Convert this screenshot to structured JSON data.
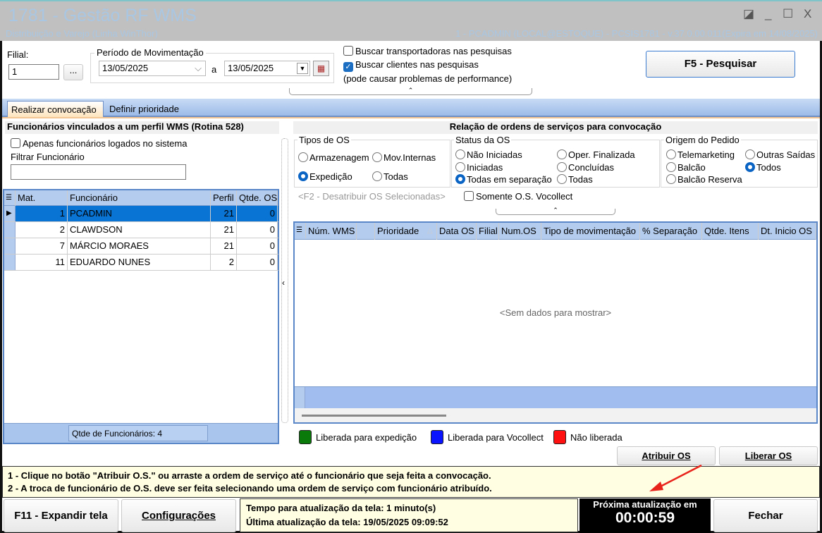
{
  "window": {
    "title": "1781 - Gestão RF WMS",
    "subtitle": "Distribuição e Varejo (Linha WinThor)",
    "sysinfo": "1 - PCADMIN (LOCAL@ESTOQUE) - PCSIS1781 - v.37.0.00.011(Expira em 14/08/2025)",
    "controls": [
      "◪",
      "_",
      "☐",
      "X"
    ]
  },
  "filters": {
    "filial_label": "Filial:",
    "filial_value": "1",
    "lookup_label": "...",
    "periodo_label": "Período de Movimentação",
    "date_from": "13/05/2025",
    "sep": "a",
    "date_to": "13/05/2025",
    "chk_transportadoras": "Buscar transportadoras nas pesquisas",
    "chk_clientes": "Buscar clientes nas pesquisas",
    "chk_note": "(pode causar problemas de performance)",
    "search_button": "F5 - Pesquisar"
  },
  "tabs": [
    "Realizar convocação",
    "Definir prioridade"
  ],
  "left": {
    "heading": "Funcionários vinculados a um perfil WMS  (Rotina 528)",
    "chk_logados": "Apenas funcionários logados no sistema",
    "filter_label": "Filtrar Funcionário",
    "filter_value": "",
    "columns": [
      "Mat.",
      "Funcionário",
      "Perfil",
      "Qtde. OS"
    ],
    "rows": [
      [
        "1",
        "PCADMIN",
        "21",
        "0"
      ],
      [
        "2",
        "CLAWDSON",
        "21",
        "0"
      ],
      [
        "7",
        "MÁRCIO MORAES",
        "21",
        "0"
      ],
      [
        "11",
        "EDUARDO NUNES",
        "2",
        "0"
      ]
    ],
    "footer": "Qtde de Funcionários: 4"
  },
  "right": {
    "heading": "Relação de ordens de serviços para convocação",
    "tipos": {
      "label": "Tipos de OS",
      "options": [
        "Armazenagem",
        "Mov.Internas",
        "Expedição",
        "Todas"
      ],
      "selected": "Expedição"
    },
    "status": {
      "label": "Status da OS",
      "options": [
        "Não Iniciadas",
        "Oper. Finalizada",
        "Iniciadas",
        "Concluídas",
        "Todas em separação",
        "Todas"
      ],
      "selected": "Todas em separação"
    },
    "origem": {
      "label": "Origem do Pedido",
      "options": [
        "Telemarketing",
        "Outras Saídas",
        "Balcão",
        "Todos",
        "Balcão Reserva"
      ],
      "selected": "Todos"
    },
    "f2_label": "<F2  - Desatribuir OS Selecionadas>",
    "chk_vocollect": "Somente O.S. Vocollect",
    "columns": [
      "Núm. WMS",
      "",
      "Prioridade",
      "Data OS",
      "Filial",
      "Num.OS",
      "Tipo de movimentação",
      "% Separação",
      "Qtde. Itens",
      "Dt. Inicio OS"
    ],
    "empty": "<Sem dados para mostrar>",
    "legend": [
      {
        "label": "Liberada para expedição",
        "color": "#0a7a0a"
      },
      {
        "label": "Liberada para Vocollect",
        "color": "#0a14ff"
      },
      {
        "label": "Não liberada",
        "color": "#ff1010"
      }
    ],
    "btn_atribuir": "Atribuir OS",
    "btn_liberar": "Liberar OS"
  },
  "instructions": [
    "1 - Clique no botão \"Atribuir O.S.\" ou arraste a ordem de serviço até o funcionário que seja feita a convocação.",
    "2 - A troca de funcionário de O.S. deve ser feita selecionando uma ordem de serviço com funcionário atribuído."
  ],
  "bottom": {
    "expand": "F11 - Expandir tela",
    "config": "Configurações",
    "tempo": "Tempo para atualização da tela: 1 minuto(s)",
    "ultima": "Última atualização da tela: 19/05/2025 09:09:52",
    "proxima_label": "Próxima atualização em",
    "countdown": "00:00:59",
    "fechar": "Fechar"
  }
}
